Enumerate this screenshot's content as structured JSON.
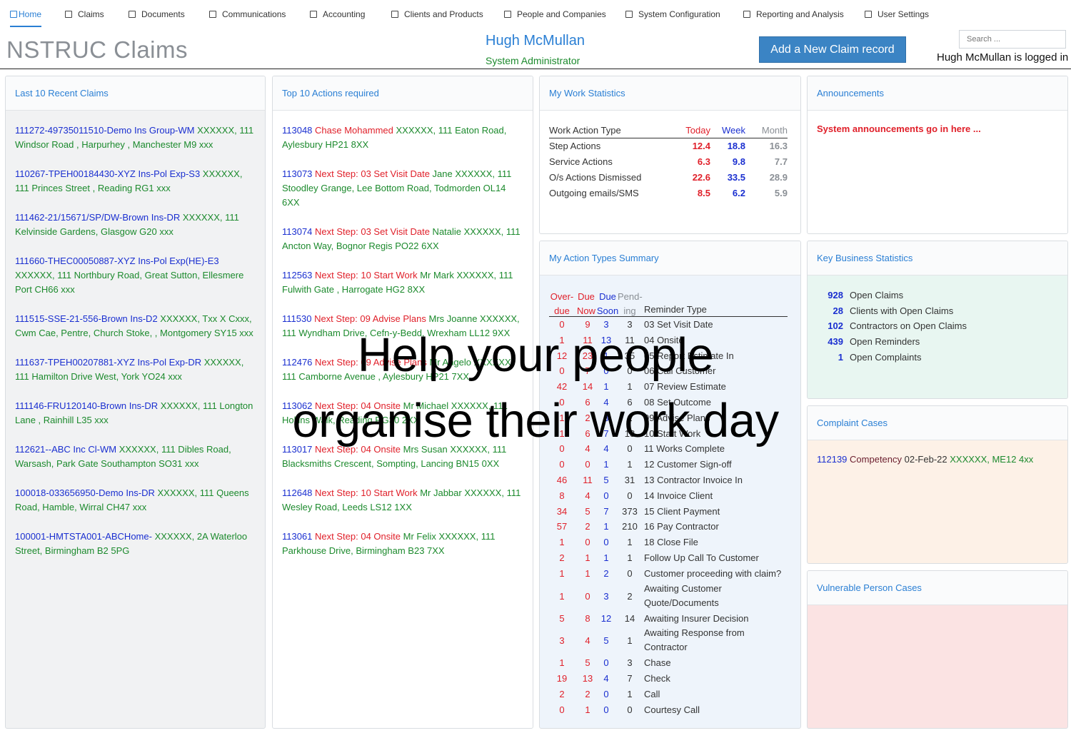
{
  "nav": {
    "items": [
      {
        "label": "Home",
        "active": true
      },
      {
        "label": "Claims"
      },
      {
        "label": "Documents"
      },
      {
        "label": "Communications"
      },
      {
        "label": "Accounting"
      },
      {
        "label": "Clients and Products"
      },
      {
        "label": "People and Companies"
      },
      {
        "label": "System Configuration"
      },
      {
        "label": "Reporting and Analysis"
      },
      {
        "label": "User Settings"
      }
    ]
  },
  "header": {
    "app_title": "NSTRUC Claims",
    "user_name": "Hugh McMullan",
    "user_role": "System Administrator",
    "add_button": "Add a New Claim record",
    "search_placeholder": "Search ...",
    "logged_in_text": "Hugh McMullan is logged in"
  },
  "recent_claims": {
    "title": "Last 10 Recent Claims",
    "items": [
      {
        "id": "111272-49735011510-Demo Ins Group-WM",
        "name": " XXXXXX,",
        "address": " 111 Windsor Road , Harpurhey , Manchester M9 xxx"
      },
      {
        "id": "110267-TPEH00184430-XYZ Ins-Pol Exp-S3",
        "name": " XXXXXX,",
        "address": " 111 Princes Street , Reading RG1 xxx"
      },
      {
        "id": "111462-21/15671/SP/DW-Brown Ins-DR",
        "name": " XXXXXX, 111",
        "address": " Kelvinside Gardens, Glasgow G20 xxx"
      },
      {
        "id": "111660-THEC00050887-XYZ Ins-Pol Exp(HE)-E3",
        "name": " XXXXXX, 111 Northbury Road, Great Sutton,",
        "address": " Ellesmere Port CH66 xxx"
      },
      {
        "id": "111515-SSE-21-556-Brown Ins-D2",
        "name": " XXXXXX, Txx X Cxxx,",
        "address": " Cwm Cae, Pentre, Church Stoke, , Montgomery SY15 xxx"
      },
      {
        "id": "111637-TPEH00207881-XYZ Ins-Pol Exp-DR",
        "name": " XXXXXX,",
        "address": " 111 Hamilton Drive West, York YO24 xxx"
      },
      {
        "id": "111146-FRU120140-Brown Ins-DR",
        "name": " XXXXXX, 111",
        "address": " Longton Lane , Rainhill L35 xxx"
      },
      {
        "id": "112621--ABC Inc Cl-WM",
        "name": " XXXXXX, 111 Dibles Road,",
        "address": " Warsash, Park Gate Southampton SO31 xxx"
      },
      {
        "id": "100018-033656950-Demo Ins-DR",
        "name": " XXXXXX, 111",
        "address": " Queens Road, Hamble, Wirral CH47 xxx"
      },
      {
        "id": "100001-HMTSTA001-ABCHome-",
        "name": " XXXXXX, 2A Waterloo",
        "address": " Street, Birmingham B2 5PG"
      }
    ]
  },
  "top_actions": {
    "title": "Top 10 Actions required",
    "items": [
      {
        "id": "113048",
        "step": " Chase Mohammed",
        "rest": " XXXXXX, 111 Eaton Road, Aylesbury HP21 8XX"
      },
      {
        "id": "113073",
        "step": " Next Step: 03 Set Visit Date",
        "rest": " Jane XXXXXX, 111 Stoodley Grange, Lee Bottom Road, Todmorden OL14 6XX"
      },
      {
        "id": "113074",
        "step": " Next Step: 03 Set Visit Date",
        "rest": " Natalie XXXXXX, 111 Ancton Way, Bognor Regis PO22 6XX"
      },
      {
        "id": "112563",
        "step": " Next Step: 10 Start Work",
        "rest": " Mr Mark XXXXXX, 111 Fulwith Gate , Harrogate HG2 8XX"
      },
      {
        "id": "111530",
        "step": " Next Step: 09 Advise Plans",
        "rest": " Mrs Joanne XXXXXX, 111 Wyndham Drive, Cefn-y-Bedd, Wrexham LL12 9XX"
      },
      {
        "id": "112476",
        "step": " Next Step: 09 Advise Plans",
        "rest": " Mr Angelo XXXXXX, 111 Camborne Avenue , Aylesbury HP21 7XX"
      },
      {
        "id": "113062",
        "step": " Next Step: 04 Onsite",
        "rest": " Mr Michael XXXXXX, 111 Hollins Walk, Reading RG30 2XX"
      },
      {
        "id": "113017",
        "step": " Next Step: 04 Onsite",
        "rest": " Mrs Susan XXXXXX, 111 Blacksmiths Crescent, Sompting, Lancing BN15 0XX"
      },
      {
        "id": "112648",
        "step": " Next Step: 10 Start Work",
        "rest": " Mr Jabbar XXXXXX, 111 Wesley Road, Leeds LS12 1XX"
      },
      {
        "id": "113061",
        "step": " Next Step: 04 Onsite",
        "rest": " Mr Felix XXXXXX, 111 Parkhouse Drive, Birmingham B23 7XX"
      }
    ]
  },
  "work_stats": {
    "title": "My Work Statistics",
    "headers": {
      "type": "Work Action Type",
      "today": "Today",
      "week": "Week",
      "month": "Month"
    },
    "rows": [
      {
        "label": "Step Actions",
        "today": "12.4",
        "week": "18.8",
        "month": "16.3"
      },
      {
        "label": "Service Actions",
        "today": "6.3",
        "week": "9.8",
        "month": "7.7"
      },
      {
        "label": "O/s Actions Dismissed",
        "today": "22.6",
        "week": "33.5",
        "month": "28.9"
      },
      {
        "label": "Outgoing emails/SMS",
        "today": "8.5",
        "week": "6.2",
        "month": "5.9"
      }
    ]
  },
  "action_summary": {
    "title": "My Action Types Summary",
    "headers": {
      "overdue": "Over-due",
      "due_now": "Due Now",
      "due_soon": "Due Soon",
      "pending": "Pend-ing",
      "reminder": "Reminder Type"
    },
    "rows": [
      {
        "o": "0",
        "n": "9",
        "s": "3",
        "p": "3",
        "t": "03 Set Visit Date"
      },
      {
        "o": "1",
        "n": "11",
        "s": "13",
        "p": "11",
        "t": "04 Onsite"
      },
      {
        "o": "12",
        "n": "23",
        "s": "1",
        "p": "35",
        "t": "05 Report Estimate In"
      },
      {
        "o": "0",
        "n": "7",
        "s": "0",
        "p": "0",
        "t": "06 Call Customer"
      },
      {
        "o": "42",
        "n": "14",
        "s": "1",
        "p": "1",
        "t": "07 Review Estimate"
      },
      {
        "o": "0",
        "n": "6",
        "s": "4",
        "p": "6",
        "t": "08 Set Outcome"
      },
      {
        "o": "1",
        "n": "2",
        "s": "3",
        "p": "1",
        "t": "09 Advise Plans"
      },
      {
        "o": "1",
        "n": "6",
        "s": "7",
        "p": "13",
        "t": "10 Start Work"
      },
      {
        "o": "0",
        "n": "4",
        "s": "4",
        "p": "0",
        "t": "11 Works Complete"
      },
      {
        "o": "0",
        "n": "0",
        "s": "1",
        "p": "1",
        "t": "12 Customer Sign-off"
      },
      {
        "o": "46",
        "n": "11",
        "s": "5",
        "p": "31",
        "t": "13 Contractor Invoice In"
      },
      {
        "o": "8",
        "n": "4",
        "s": "0",
        "p": "0",
        "t": "14 Invoice Client"
      },
      {
        "o": "34",
        "n": "5",
        "s": "7",
        "p": "373",
        "t": "15 Client Payment"
      },
      {
        "o": "57",
        "n": "2",
        "s": "1",
        "p": "210",
        "t": "16 Pay Contractor"
      },
      {
        "o": "1",
        "n": "0",
        "s": "0",
        "p": "1",
        "t": "18 Close File"
      },
      {
        "o": "2",
        "n": "1",
        "s": "1",
        "p": "1",
        "t": "Follow Up Call To Customer"
      },
      {
        "o": "1",
        "n": "1",
        "s": "2",
        "p": "0",
        "t": "Customer proceeding with claim?"
      },
      {
        "o": "1",
        "n": "0",
        "s": "3",
        "p": "2",
        "t": "Awaiting Customer Quote/Documents",
        "tall": true
      },
      {
        "o": "5",
        "n": "8",
        "s": "12",
        "p": "14",
        "t": "Awaiting Insurer Decision"
      },
      {
        "o": "3",
        "n": "4",
        "s": "5",
        "p": "1",
        "t": "Awaiting Response from Contractor",
        "tall": true
      },
      {
        "o": "1",
        "n": "5",
        "s": "0",
        "p": "3",
        "t": "Chase"
      },
      {
        "o": "19",
        "n": "13",
        "s": "4",
        "p": "7",
        "t": "Check"
      },
      {
        "o": "2",
        "n": "2",
        "s": "0",
        "p": "1",
        "t": "Call"
      },
      {
        "o": "0",
        "n": "1",
        "s": "0",
        "p": "0",
        "t": "Courtesy Call"
      }
    ]
  },
  "announcements": {
    "title": "Announcements",
    "text": "System announcements go in here ..."
  },
  "key_stats": {
    "title": "Key Business Statistics",
    "rows": [
      {
        "num": "928",
        "label": "Open Claims"
      },
      {
        "num": "28",
        "label": "Clients with Open Claims"
      },
      {
        "num": "102",
        "label": "Contractors on Open Claims"
      },
      {
        "num": "439",
        "label": "Open Reminders"
      },
      {
        "num": "1",
        "label": "Open Complaints"
      }
    ]
  },
  "complaints": {
    "title": "Complaint Cases",
    "items": [
      {
        "id": "112139",
        "type": " Competency",
        "date": " 02-Feb-22",
        "rest": " XXXXXX, ME12 4xx"
      }
    ]
  },
  "vulnerable": {
    "title": "Vulnerable Person Cases"
  },
  "overlay": {
    "line1": "Help your people",
    "line2": "organise their work day"
  },
  "colors": {
    "accent": "#2a7fd4",
    "id_blue": "#1a2fd0",
    "alert_red": "#e0202a",
    "address_green": "#1c8a2d",
    "key_stats_bg": "#e8f6f1",
    "complaint_bg": "#fdf1e7",
    "vulnerable_bg": "#fbe3e3",
    "summary_bg": "#eef4fb"
  }
}
